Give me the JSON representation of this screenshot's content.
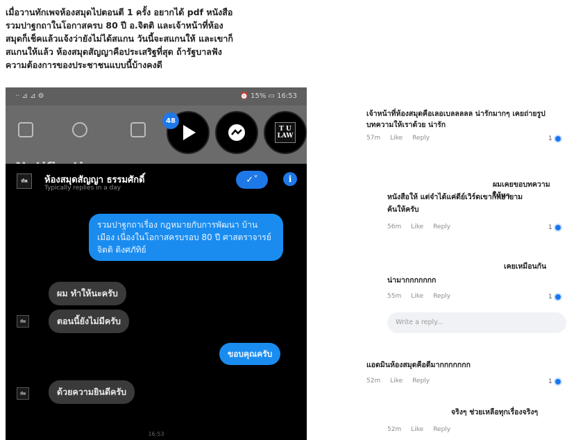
{
  "caption": {
    "line1": "เมื่อวานทักเพจห้องสมุดไปตอนตี 1 ครั้ง อยากได้ pdf หนังสือ",
    "line2": "รวมปาฐกถาในโอกาสครบ 80 ปี อ.จิตติ และเจ้าหน้าที่ห้อง",
    "line3": "สมุดก็เช็คแล้วแจ้งว่ายังไม่ได้สแกน วันนี้จะสแกนให้ และเขาก็",
    "line4": "สแกนให้แล้ว ห้องสมุดสัญญาคือประเสริฐที่สุด ถ้ารัฐบาลฟัง",
    "line5": "ความต้องการของประชาชนแบบนี้บ้างคงดี"
  },
  "phone": {
    "status_left": "·· ⊿ ⊿ ⚙",
    "status_right": "⏰ 15% ▭ 16:53",
    "notifications_title": "Notifications",
    "badge_count": "48",
    "tu_law": "T U\nLAW",
    "chat": {
      "page_avatar": "ทัพ",
      "page_name": "ห้องสมุดสัญญา ธรรมศักดิ์",
      "page_sub": "Typically replies in a day",
      "check_label": "✓˅",
      "info_label": "i",
      "msg_out_1": "รวมปาฐกถาเรื่อง กฎหมายกับการพัฒนา บ้านเมือง เนื่องในโอกาสครบรอบ 80 ปี ศาสตราจารย์จิตติ ติงศภัทิย์",
      "msg_in_1": "ผม ทำให้นะครับ",
      "msg_in_2": "ตอนนี้ยังไม่มีครับ",
      "msg_out_2": "ขอบคุณครับ",
      "msg_in_3": "ด้วยความยินดีครับ",
      "time": "16:53"
    }
  },
  "comments": {
    "c1_text": "เจ้าหน้าที่ห้องสมุดคือเลอเบลลลลล น่ารักมากๆ เคยถ่ายรูปบทความให้เราด้วย น่ารัก",
    "c1_time": "57m",
    "c1_count": "1",
    "c2_text_a": "ผมเคยขอบทความให้หา",
    "c2_text_b": "หนังสือให้ แต่จำได้แค่ดีย์เวิร์ดเขาก็พยายาม",
    "c2_text_c": "ค้นให้ครับ",
    "c2_time": "56m",
    "c2_count": "1",
    "c3_text_a": "เคยเหมือนกัน",
    "c3_text_b": "น่ามากกกกกกก",
    "c3_time": "55m",
    "c3_count": "1",
    "reply_placeholder": "Write a reply...",
    "c4_text": "แอดมินห้องสมุดคือดีมากกกกกกก",
    "c4_time": "52m",
    "c4_count": "1",
    "c5_text": "จริงๆ ช่วยเหลือทุกเรื่องจริงๆ",
    "c5_time": "52m",
    "like": "Like",
    "reply": "Reply"
  }
}
